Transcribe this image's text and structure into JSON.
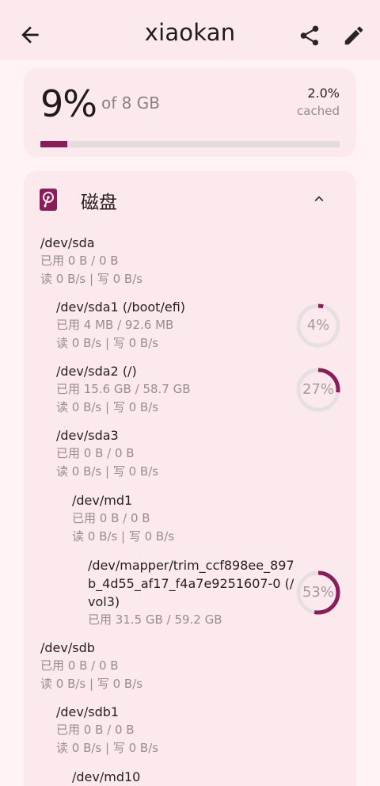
{
  "appbar": {
    "title": "xiaokan",
    "back_icon": "arrow-back-icon",
    "share_icon": "share-icon",
    "edit_icon": "pencil-icon"
  },
  "memory": {
    "percent": "9%",
    "of_total": "of 8 GB",
    "cached_value": "2.0%",
    "cached_label": "cached",
    "usage_fraction": 0.09
  },
  "disk_section": {
    "title": "磁盘",
    "icon": "hard-disk-icon",
    "collapse_icon": "chevron-up-icon",
    "devices": [
      {
        "name": "/dev/sda",
        "used": "已用 0 B / 0 B",
        "io": "读 0 B/s | 写 0 B/s"
      },
      {
        "name": "/dev/sda1 (/boot/efi)",
        "used": "已用 4 MB / 92.6 MB",
        "io": "读 0 B/s | 写 0 B/s",
        "ring": "4%",
        "fraction": 0.04
      },
      {
        "name": "/dev/sda2 (/)",
        "used": "已用 15.6 GB / 58.7 GB",
        "io": "读 0 B/s | 写 0 B/s",
        "ring": "27%",
        "fraction": 0.27
      },
      {
        "name": "/dev/sda3",
        "used": "已用 0 B / 0 B",
        "io": "读 0 B/s | 写 0 B/s"
      },
      {
        "name": "/dev/md1",
        "used": "已用 0 B / 0 B",
        "io": "读 0 B/s | 写 0 B/s"
      },
      {
        "name_lines": [
          "/dev/mapper/trim_ccf898ee_897",
          "b_4d55_af17_f4a7e9251607-0 (/",
          "vol3)"
        ],
        "used": "已用 31.5 GB / 59.2 GB",
        "ring": "53%",
        "fraction": 0.53
      },
      {
        "name": "/dev/sdb",
        "used": "已用 0 B / 0 B",
        "io": "读 0 B/s | 写 0 B/s"
      },
      {
        "name": "/dev/sdb1",
        "used": "已用 0 B / 0 B",
        "io": "读 0 B/s | 写 0 B/s"
      },
      {
        "name": "/dev/md10"
      }
    ]
  },
  "colors": {
    "accent": "#8a1d59",
    "track": "#e6e0e2"
  }
}
